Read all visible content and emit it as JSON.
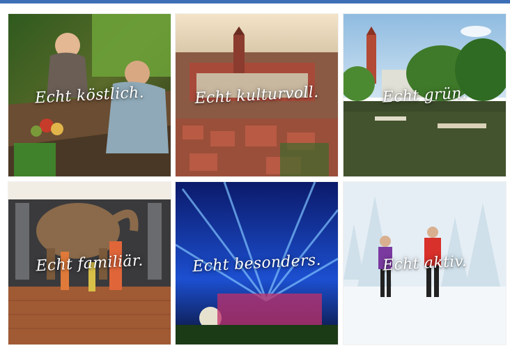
{
  "tiles": [
    {
      "caption": "Echt köstlich.",
      "scene": "dining-outdoors"
    },
    {
      "caption": "Echt kulturvoll.",
      "scene": "old-town-aerial"
    },
    {
      "caption": "Echt grün.",
      "scene": "lake-with-boats"
    },
    {
      "caption": "Echt familiär.",
      "scene": "museum-mammoth"
    },
    {
      "caption": "Echt besonders.",
      "scene": "light-show"
    },
    {
      "caption": "Echt aktiv.",
      "scene": "winter-ski"
    }
  ],
  "colors": {
    "topbar": "#3d6fb6",
    "caption": "#ffffff"
  }
}
